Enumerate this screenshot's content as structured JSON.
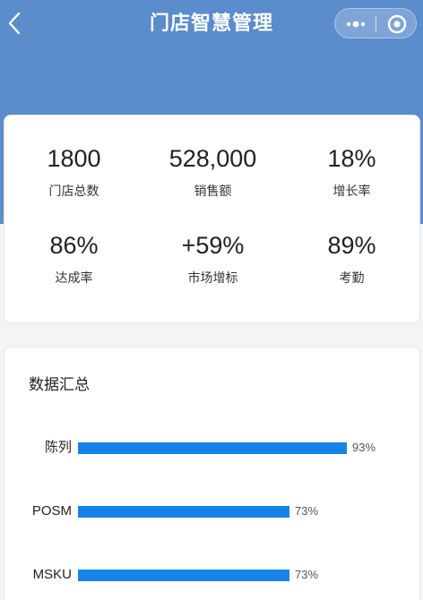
{
  "nav": {
    "title": "门店智慧管理"
  },
  "colors": {
    "header": "#5b8ccb",
    "bar": "#1583e8"
  },
  "icons": {
    "back": "chevron-left-icon",
    "more": "more-dots-icon",
    "close": "target-circle-icon"
  },
  "stats": [
    {
      "value": "1800",
      "label": "门店总数"
    },
    {
      "value": "528,000",
      "label": "销售额"
    },
    {
      "value": "18%",
      "label": "增长率"
    },
    {
      "value": "86%",
      "label": "达成率"
    },
    {
      "value": "+59%",
      "label": "市场增标"
    },
    {
      "value": "89%",
      "label": "考勤"
    }
  ],
  "summary": {
    "title": "数据汇总"
  },
  "chart_data": {
    "type": "bar",
    "orientation": "horizontal",
    "categories": [
      "陈列",
      "POSM",
      "MSKU"
    ],
    "values": [
      93,
      73,
      73
    ],
    "value_labels": [
      "93%",
      "73%",
      "73%"
    ],
    "title": "数据汇总"
  }
}
